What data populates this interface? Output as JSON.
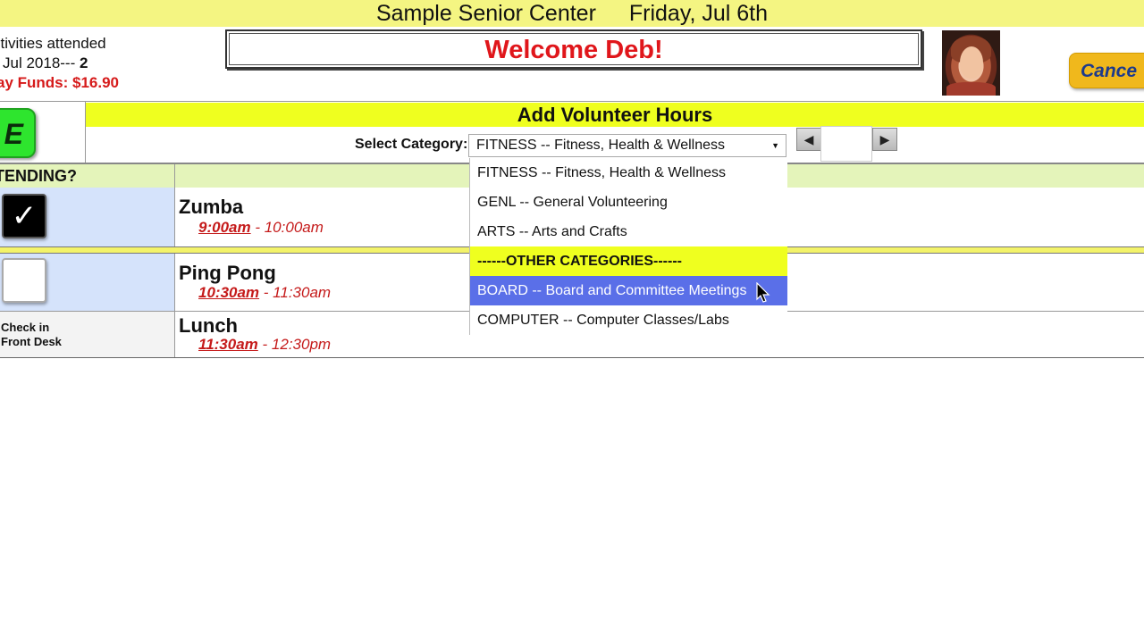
{
  "header": {
    "center_name": "Sample Senior Center",
    "date": "Friday, Jul 6th"
  },
  "stats": {
    "line1": "ctivities attended",
    "line2_prefix": "Jul 2018---",
    "line2_count": "2",
    "line3": "ay Funds: $16.90"
  },
  "welcome": "Welcome Deb!",
  "cancel_label": "Cance",
  "save_label": "E",
  "volunteer": {
    "title": "Add Volunteer Hours",
    "category_label": "Select Category:",
    "selected_category": "FITNESS -- Fitness, Health & Wellness",
    "stepper_left": "◀",
    "stepper_right": "▶",
    "options": [
      {
        "label": "FITNESS -- Fitness, Health & Wellness",
        "type": "option"
      },
      {
        "label": "GENL -- General Volunteering",
        "type": "option"
      },
      {
        "label": "ARTS -- Arts and Crafts",
        "type": "option"
      },
      {
        "label": "------OTHER CATEGORIES------",
        "type": "group"
      },
      {
        "label": "BOARD -- Board and Committee Meetings",
        "type": "highlighted"
      },
      {
        "label": "COMPUTER -- Computer Classes/Labs",
        "type": "option"
      }
    ]
  },
  "attending_label": "TENDING?",
  "activities": [
    {
      "name": "Zumba",
      "start": "9:00am",
      "end": "- 10:00am",
      "checked": true
    },
    {
      "name": "Ping Pong",
      "start": "10:30am",
      "end": "- 11:30am",
      "checked": false
    },
    {
      "name": "Lunch",
      "start": "11:30am",
      "end": "- 12:30pm",
      "note_line1": "Check in",
      "note_line2": "Front Desk"
    }
  ],
  "colors": {
    "topbar": "#f4f582",
    "highlight_yellow": "#efff1f",
    "selected_option": "#5a6fe8",
    "time_red": "#c51b1b",
    "save_green": "#2ee52e",
    "cancel_orange": "#f0b81c"
  }
}
